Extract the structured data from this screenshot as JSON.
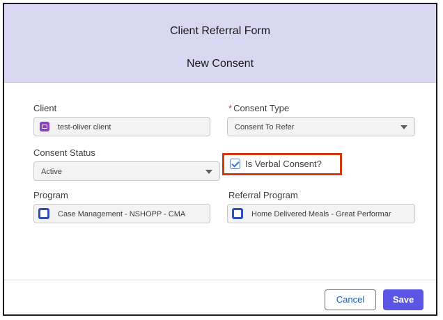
{
  "header": {
    "title": "Client Referral Form",
    "subtitle": "New Consent"
  },
  "form": {
    "client": {
      "label": "Client",
      "value": "test-oliver client",
      "icon": "contact-record-icon"
    },
    "consent_type": {
      "required_mark": "*",
      "label": "Consent Type",
      "value": "Consent To Refer"
    },
    "consent_status": {
      "label": "Consent Status",
      "value": "Active"
    },
    "verbal_consent": {
      "label": "Is Verbal Consent?",
      "checked": true
    },
    "program": {
      "label": "Program",
      "value": "Case Management - NSHOPP - CMA",
      "icon": "program-icon"
    },
    "referral_program": {
      "label": "Referral Program",
      "value": "Home Delivered Meals - Great Performar",
      "icon": "program-icon"
    }
  },
  "footer": {
    "cancel_label": "Cancel",
    "save_label": "Save"
  },
  "colors": {
    "header_bg": "#d9d7f1",
    "primary": "#5b55e4",
    "highlight": "#d4380d",
    "required": "#c23934"
  }
}
